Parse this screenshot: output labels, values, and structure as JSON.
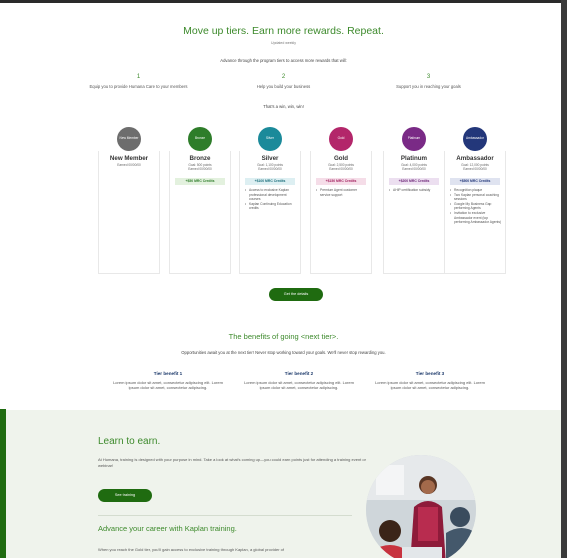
{
  "hero": {
    "title": "Move up tiers. Earn more rewards. Repeat.",
    "subtitle": "Updated weekly",
    "description": "Advance through the program tiers to access more rewards that will:"
  },
  "steps": [
    {
      "num": "1",
      "text": "Equip you to provide Humana Care to your members"
    },
    {
      "num": "2",
      "text": "Help you build your business"
    },
    {
      "num": "3",
      "text": "Support you in reaching your goals"
    }
  ],
  "tagline": "That's a win, win, win!",
  "tiers": [
    {
      "badge": "New Member",
      "name": "New Member",
      "meta": [
        "Earned 00/00/00"
      ],
      "credit": "",
      "bullets": [],
      "color": "#6d6d6d"
    },
    {
      "badge": "Bronze",
      "name": "Bronze",
      "meta": [
        "Goal: 500 points",
        "Earned 00/00/00"
      ],
      "credit": "+$50 MRC Credits",
      "bullets": [],
      "color": "#2e7d2a",
      "credit_bg": "#e3f1de",
      "credit_color": "#2e7d2a"
    },
    {
      "badge": "Silver",
      "name": "Silver",
      "meta": [
        "Goal: 1,100 points",
        "Earned 00/00/00"
      ],
      "credit": "+$100 MRC Credits",
      "bullets": [
        "Access to exclusive Kaplan professional development courses",
        "Kaplan Continuing Education credits"
      ],
      "color": "#1b8a9a",
      "credit_bg": "#ddeff2",
      "credit_color": "#1b6f7c"
    },
    {
      "badge": "Gold",
      "name": "Gold",
      "meta": [
        "Goal: 2,500 points",
        "Earned 00/00/00"
      ],
      "credit": "+$150 MRC Credits",
      "bullets": [
        "Premium Agent customer service support"
      ],
      "color": "#b3266a",
      "credit_bg": "#f5dde8",
      "credit_color": "#a21f5e"
    },
    {
      "badge": "Platinum",
      "name": "Platinum",
      "meta": [
        "Goal: 4,000 points",
        "Earned 00/00/00"
      ],
      "credit": "+$200 MRC Credits",
      "bullets": [
        "AHIP certification subsidy"
      ],
      "color": "#7a2a86",
      "credit_bg": "#ecdff0",
      "credit_color": "#6c2377"
    },
    {
      "badge": "Ambassador",
      "name": "Ambassador",
      "meta": [
        "Goal: 12,000 points",
        "Earned 00/00/00"
      ],
      "credit": "+$500 MRC Credits",
      "bullets": [
        "Recognition plaque",
        "Two Kaplan personal coaching sessions",
        "Google My Business Gap performing Agents",
        "Invitation to exclusive Ambassador event (top performing Ambassador Agents)"
      ],
      "color": "#23377a",
      "credit_bg": "#dfe3f0",
      "credit_color": "#23377a"
    }
  ],
  "cta_label": "Get the details",
  "benefits_section": {
    "title": "The benefits of going <next tier>.",
    "description": "Opportunities await you at the next tier! Never stop working toward your goals. We'll never stop rewarding you.",
    "items": [
      {
        "title": "Tier benefit 1",
        "text": "Lorem ipsum dolor sit amet, consectetur adipiscing elit. Lorem ipsum dolor sit amet, consectetur adipiscing."
      },
      {
        "title": "Tier benefit 2",
        "text": "Lorem ipsum dolor sit amet, consectetur adipiscing elit. Lorem ipsum dolor sit amet, consectetur adipiscing."
      },
      {
        "title": "Tier benefit 3",
        "text": "Lorem ipsum dolor sit amet, consectetur adipiscing elit. Lorem ipsum dolor sit amet, consectetur adipiscing."
      }
    ]
  },
  "learn": {
    "title": "Learn to earn.",
    "description": "At Humana, training is designed with your purpose in mind. Take a look at what's coming up—you could earn points just for attending a training event or webinar!",
    "button_label": "See training",
    "advance_title": "Advance your career with Kaplan training.",
    "advance_description": "When you reach the Gold tier, you'll gain access to exclusive training through Kaplan, a global provider of"
  },
  "colors": {
    "brand_green": "#1f6b10",
    "accent_green": "#3d8a2c",
    "learn_bg": "#eff3ec"
  }
}
